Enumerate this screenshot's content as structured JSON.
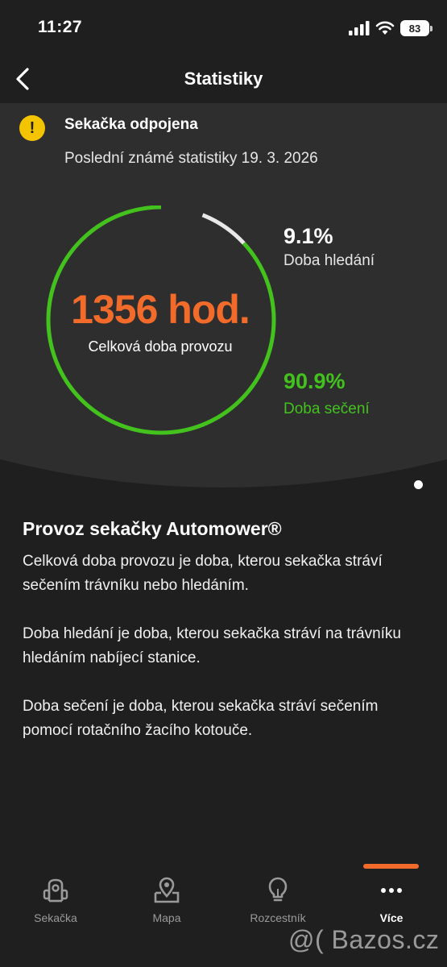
{
  "status_bar": {
    "time": "11:27",
    "battery": "83"
  },
  "nav": {
    "title": "Statistiky"
  },
  "alert": {
    "title": "Sekačka odpojena",
    "subtitle": "Poslední známé statistiky 19. 3. 2026"
  },
  "stats": {
    "total_value": "1356 hod.",
    "total_label": "Celková doba provozu",
    "search_percent_text": "9.1%",
    "search_label": "Doba hledání",
    "mowing_percent_text": "90.9%",
    "mowing_label": "Doba sečení",
    "search_fraction": 0.091,
    "mowing_fraction": 0.909
  },
  "info": {
    "title": "Provoz sekačky Automower®",
    "p1": "Celková doba provozu je doba, kterou sekačka stráví sečením trávníku nebo hledáním.",
    "p2": "Doba hledání je doba, kterou sekačka stráví na trávníku hledáním nabíjecí stanice.",
    "p3": "Doba sečení je doba, kterou sekačka stráví sečením pomocí rotačního žacího kotouče."
  },
  "tabs": [
    {
      "label": "Sekačka",
      "icon": "mower-icon"
    },
    {
      "label": "Mapa",
      "icon": "map-icon"
    },
    {
      "label": "Rozcestník",
      "icon": "lightbulb-icon"
    },
    {
      "label": "Více",
      "icon": "more-icon"
    }
  ],
  "watermark": "@( Bazos.cz",
  "colors": {
    "accent": "#f26b2a",
    "mowing": "#43c21e",
    "search": "#e8e8e8",
    "warning": "#f5c400",
    "background": "#1f1f1f",
    "card": "#2e2e2e"
  }
}
